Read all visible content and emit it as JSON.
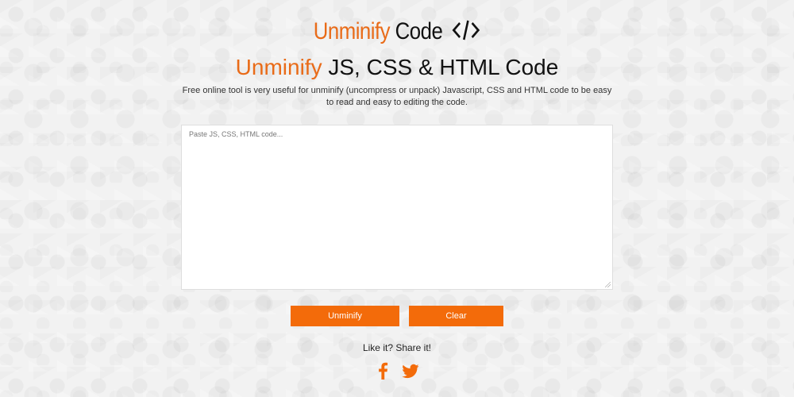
{
  "brand": {
    "logo_prefix": "Unminify",
    "logo_suffix": "Code",
    "accent_color": "#e96b18",
    "icon": "code-brackets-icon"
  },
  "heading": {
    "accent": "Unminify",
    "rest": " JS, CSS & HTML Code"
  },
  "description": "Free online tool is very useful for unminify (uncompress or unpack) Javascript, CSS and HTML code to be easy to read and easy to editing the code.",
  "editor": {
    "placeholder": "Paste JS, CSS, HTML code...",
    "value": ""
  },
  "buttons": {
    "unminify": "Unminify",
    "clear": "Clear",
    "background_color": "#f36b0a",
    "text_color": "#ffffff"
  },
  "share": {
    "label": "Like it? Share it!",
    "icons": [
      "facebook-icon",
      "twitter-icon"
    ]
  }
}
